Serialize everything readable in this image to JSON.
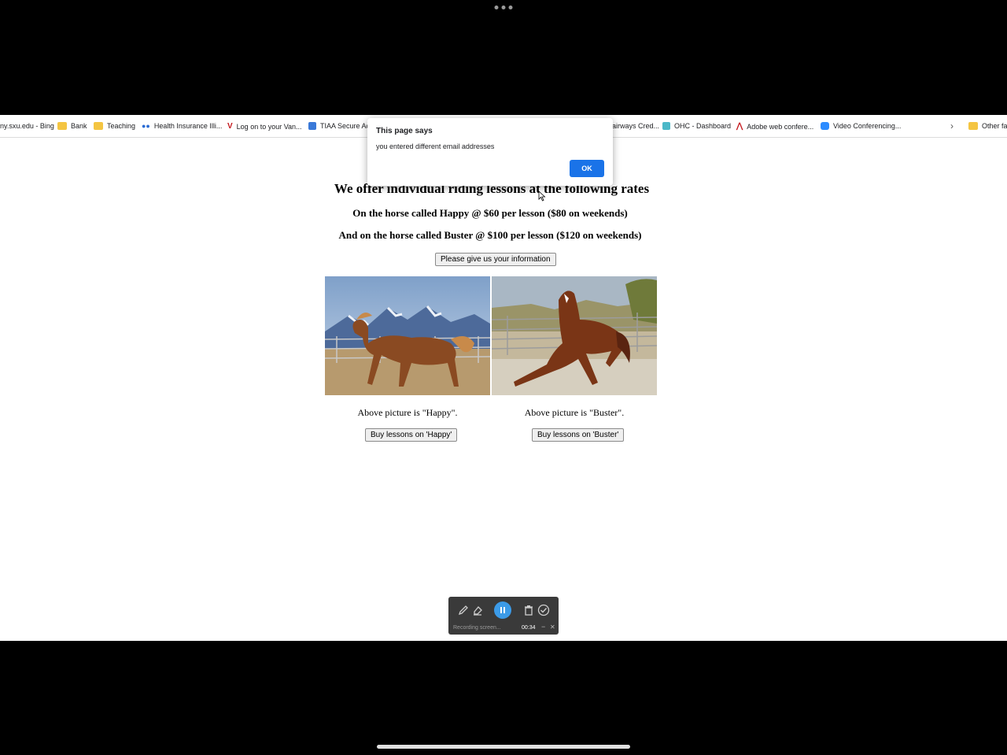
{
  "bookmarks": [
    {
      "label": "ny.sxu.edu - Bing",
      "icon": "none"
    },
    {
      "label": "Bank",
      "icon": "folder-icon"
    },
    {
      "label": "Teaching",
      "icon": "folder-icon"
    },
    {
      "label": "Health Insurance Illi...",
      "icon": "link-icon"
    },
    {
      "label": "Log on to your Van...",
      "icon": "vanguard-icon"
    },
    {
      "label": "TIAA Secure Acc",
      "icon": "tiaa-icon"
    },
    {
      "label": "airways Cred...",
      "icon": "none"
    },
    {
      "label": "OHC - Dashboard",
      "icon": "ohc-icon"
    },
    {
      "label": "Adobe web confere...",
      "icon": "adobe-icon"
    },
    {
      "label": "Video Conferencing...",
      "icon": "zoom-icon"
    },
    {
      "label": "Other fav",
      "icon": "folder-icon"
    }
  ],
  "page": {
    "heading": "We offer individual riding lessons at the following rates",
    "rate_happy": "On the horse called Happy @ $60 per lesson ($80 on weekends)",
    "rate_buster": "And on the horse called Buster @ $100 per lesson ($120 on weekends)",
    "info_button": "Please give us your information",
    "caption_happy": "Above picture is \"Happy\".",
    "caption_buster": "Above picture is \"Buster\".",
    "buy_happy": "Buy lessons on 'Happy'",
    "buy_buster": "Buy lessons on 'Buster'"
  },
  "dialog": {
    "title": "This page says",
    "message": "you entered different email addresses",
    "ok_label": "OK"
  },
  "recorder": {
    "status": "Recording screen...",
    "time": "00:34"
  },
  "colors": {
    "dialog_ok": "#1a73e8",
    "recorder_pause": "#3c9be8",
    "folder": "#f4c542"
  }
}
